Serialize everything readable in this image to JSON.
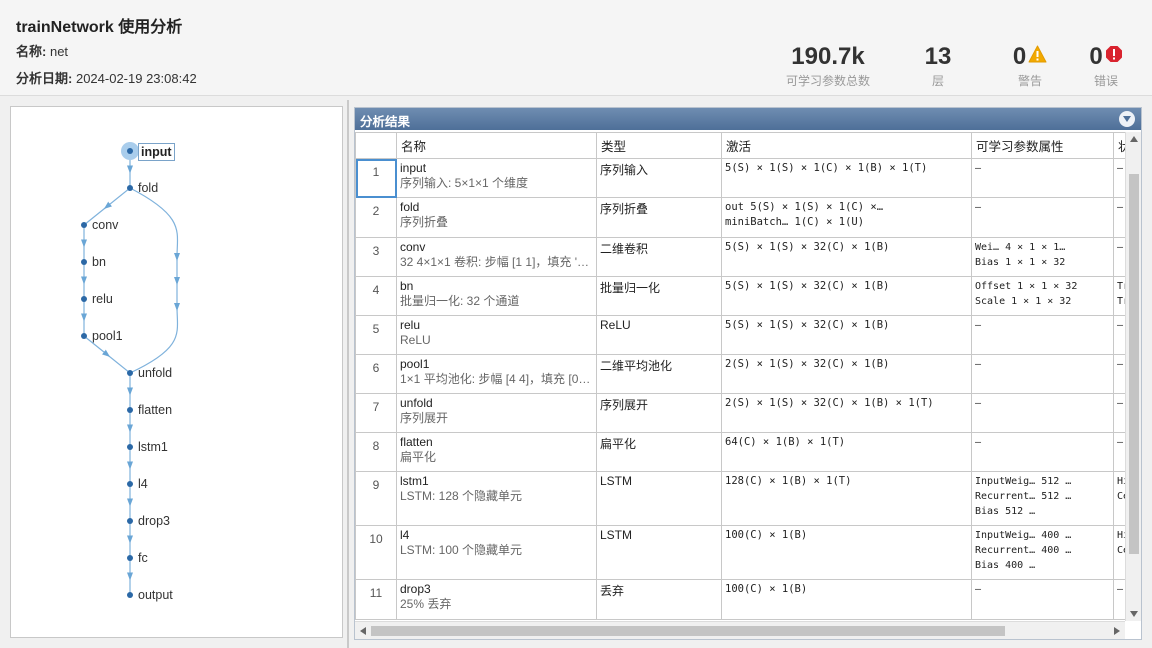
{
  "header": {
    "title": "trainNetwork 使用分析",
    "name_key": "名称:",
    "name_value": "net",
    "date_key": "分析日期:",
    "date_value": "2024-02-19 23:08:42"
  },
  "stats": {
    "params": {
      "value": "190.7k",
      "label": "可学习参数总数"
    },
    "layers": {
      "value": "13",
      "label": "层"
    },
    "warnings": {
      "value": "0",
      "label": "警告",
      "icon": "warning-icon",
      "color": "#f2a900"
    },
    "errors": {
      "value": "0",
      "label": "错误",
      "icon": "error-icon",
      "color": "#d9232e"
    }
  },
  "graph": {
    "nodes": [
      "input",
      "fold",
      "conv",
      "bn",
      "relu",
      "pool1",
      "unfold",
      "flatten",
      "lstm1",
      "l4",
      "drop3",
      "fc",
      "output"
    ],
    "selected": "input",
    "accent": "#4a8fd0"
  },
  "results": {
    "title": "分析结果",
    "columns": [
      "",
      "名称",
      "类型",
      "激活",
      "可学习参数属性",
      "状"
    ],
    "rows": [
      {
        "idx": "1",
        "name": "input",
        "desc": "序列输入: 5×1×1 个维度",
        "type": "序列输入",
        "act": [
          "5(S) × 1(S) × 1(C) × 1(B) × 1(T)"
        ],
        "params": [
          "–"
        ],
        "state": [
          "–"
        ]
      },
      {
        "idx": "2",
        "name": "fold",
        "desc": "序列折叠",
        "type": "序列折叠",
        "act": [
          "out        5(S) × 1(S) × 1(C) ×…",
          "miniBatch…  1(C) × 1(U)"
        ],
        "params": [
          "–"
        ],
        "state": [
          "–"
        ]
      },
      {
        "idx": "3",
        "name": "conv",
        "desc": "32 4×1×1 卷积: 步幅 [1 1]，填充 '…",
        "type": "二维卷积",
        "act": [
          "5(S) × 1(S) × 32(C) × 1(B)"
        ],
        "params": [
          "Wei…  4 × 1 × 1…",
          "Bias   1 × 1 × 32"
        ],
        "state": [
          "–"
        ]
      },
      {
        "idx": "4",
        "name": "bn",
        "desc": "批量归一化: 32 个通道",
        "type": "批量归一化",
        "act": [
          "5(S) × 1(S) × 32(C) × 1(B)"
        ],
        "params": [
          "Offset  1 × 1 × 32",
          "Scale   1 × 1 × 32"
        ],
        "state": [
          "Tr",
          "Tr"
        ]
      },
      {
        "idx": "5",
        "name": "relu",
        "desc": "ReLU",
        "type": "ReLU",
        "act": [
          "5(S) × 1(S) × 32(C) × 1(B)"
        ],
        "params": [
          "–"
        ],
        "state": [
          "–"
        ]
      },
      {
        "idx": "6",
        "name": "pool1",
        "desc": "1×1 平均池化: 步幅 [4 4]，填充 [0…",
        "type": "二维平均池化",
        "act": [
          "2(S) × 1(S) × 32(C) × 1(B)"
        ],
        "params": [
          "–"
        ],
        "state": [
          "–"
        ]
      },
      {
        "idx": "7",
        "name": "unfold",
        "desc": "序列展开",
        "type": "序列展开",
        "act": [
          "2(S) × 1(S) × 32(C) × 1(B) × 1(T)"
        ],
        "params": [
          "–"
        ],
        "state": [
          "–"
        ]
      },
      {
        "idx": "8",
        "name": "flatten",
        "desc": "扁平化",
        "type": "扁平化",
        "act": [
          "64(C) × 1(B) × 1(T)"
        ],
        "params": [
          "–"
        ],
        "state": [
          "–"
        ]
      },
      {
        "idx": "9",
        "name": "lstm1",
        "desc": "LSTM: 128 个隐藏单元",
        "type": "LSTM",
        "act": [
          "128(C) × 1(B) × 1(T)"
        ],
        "params": [
          "InputWeig…   512 …",
          "Recurrent…   512 …",
          "Bias         512 …"
        ],
        "state": [
          "Hi",
          "Ce"
        ]
      },
      {
        "idx": "10",
        "name": "l4",
        "desc": "LSTM: 100 个隐藏单元",
        "type": "LSTM",
        "act": [
          "100(C) × 1(B)"
        ],
        "params": [
          "InputWeig…   400 …",
          "Recurrent…   400 …",
          "Bias         400 …"
        ],
        "state": [
          "Hi",
          "Ce"
        ]
      },
      {
        "idx": "11",
        "name": "drop3",
        "desc": "25% 丢弃",
        "type": "丢弃",
        "act": [
          "100(C) × 1(B)"
        ],
        "params": [
          "–"
        ],
        "state": [
          "–"
        ]
      }
    ]
  }
}
